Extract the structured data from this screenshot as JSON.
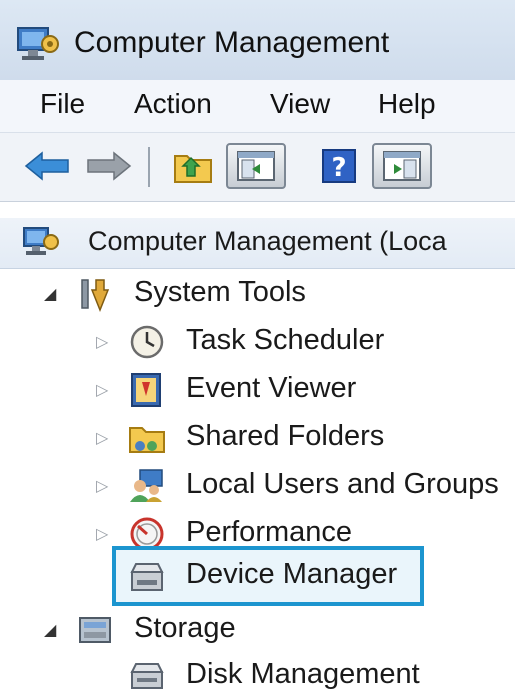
{
  "window": {
    "title": "Computer Management"
  },
  "menu": {
    "items": [
      "File",
      "Action",
      "View",
      "Help"
    ]
  },
  "toolbar": {
    "buttons": [
      "back-arrow-icon",
      "forward-arrow-icon",
      "up-folder-icon",
      "show-hide-console-tree-icon",
      "help-icon",
      "show-hide-action-pane-icon"
    ]
  },
  "tree": {
    "root": "Computer Management (Loca",
    "system_tools": "System Tools",
    "task_scheduler": "Task Scheduler",
    "event_viewer": "Event Viewer",
    "shared_folders": "Shared Folders",
    "local_users": "Local Users and Groups",
    "performance": "Performance",
    "device_manager": "Device Manager",
    "storage": "Storage",
    "disk_management": "Disk Management",
    "selected_item": "Device Manager"
  },
  "colors": {
    "selection_border": "#1c95cf",
    "titlebar": "#dde8f4",
    "toolbar_arrow": "#3b8ed8"
  }
}
